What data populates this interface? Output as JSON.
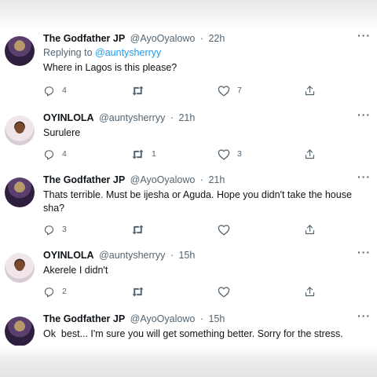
{
  "tweets": [
    {
      "author": "The Godfather JP",
      "handle": "@AyoOyalowo",
      "time": "22h",
      "replying_prefix": "Replying to",
      "replying_handle": "@auntysherryy",
      "text": "Where in Lagos is this please?",
      "replies": "4",
      "retweets": "",
      "likes": "7"
    },
    {
      "author": "OYINLOLA",
      "handle": "@auntysherryy",
      "time": "21h",
      "text": "Surulere",
      "replies": "4",
      "retweets": "1",
      "likes": "3"
    },
    {
      "author": "The Godfather JP",
      "handle": "@AyoOyalowo",
      "time": "21h",
      "text": "Thats terrible. Must be ijesha or Aguda. Hope you didn't take the house sha?",
      "replies": "3",
      "retweets": "",
      "likes": ""
    },
    {
      "author": "OYINLOLA",
      "handle": "@auntysherryy",
      "time": "15h",
      "text": "Akerele I didn't",
      "replies": "2",
      "retweets": "",
      "likes": ""
    },
    {
      "author": "The Godfather JP",
      "handle": "@AyoOyalowo",
      "time": "15h",
      "text": "Ok  best... I'm sure you will get something better. Sorry for the stress."
    }
  ],
  "separator": "·",
  "more_glyph": "···",
  "icons": {
    "reply": "reply-icon",
    "retweet": "retweet-icon",
    "like": "heart-icon",
    "share": "share-icon",
    "more": "more-icon"
  },
  "colors": {
    "text": "#0f1419",
    "secondary": "#536471",
    "link": "#1d9bf0"
  }
}
